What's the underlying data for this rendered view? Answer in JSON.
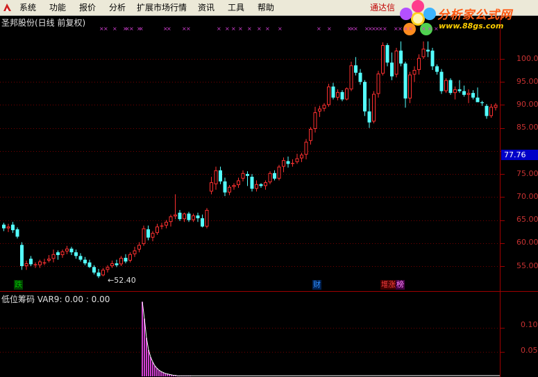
{
  "menu": {
    "items": [
      "系统",
      "功能",
      "报价",
      "分析",
      "扩展市场行情",
      "资讯",
      "工具",
      "帮助"
    ],
    "broker": "通达信"
  },
  "watermark": {
    "title": "分析家公式网",
    "url": "www.88gs.com"
  },
  "stock_title": "圣邦股份(日线 前复权)",
  "current_price_label": "77.76",
  "low_marker": "←52.40",
  "price_axis_ticks": [
    "100.0",
    "95.00",
    "90.00",
    "85.00",
    "75.00",
    "70.00",
    "65.00",
    "60.00",
    "55.00"
  ],
  "events": [
    {
      "label": "跌",
      "color": "#00c000",
      "bg": "#004000"
    },
    {
      "label": "财",
      "color": "#3090ff",
      "bg": "#002050"
    },
    {
      "label": "增",
      "color": "#ff4040",
      "bg": "#400000"
    },
    {
      "label": "涨",
      "color": "#ff4040",
      "bg": "#400000"
    },
    {
      "label": "榜",
      "color": "#ff80ff",
      "bg": "#400040"
    }
  ],
  "indicator": {
    "title": "低位筹码  VAR9: 0.00  : 0.00",
    "ticks": [
      "0.10",
      "0.05"
    ]
  },
  "colors": {
    "up": "#ff3030",
    "down": "#54ffff",
    "marker": "#d040d0",
    "grid": "#7a0000"
  },
  "chart_data": {
    "type": "candlestick",
    "ylim": [
      51,
      104
    ],
    "candles": [
      [
        64,
        64.4,
        62.6,
        63.2
      ],
      [
        63.2,
        64.2,
        62.4,
        63.6
      ],
      [
        64,
        64.6,
        62.2,
        62.8
      ],
      [
        63,
        63.4,
        61,
        61.4
      ],
      [
        59.6,
        60.2,
        54.2,
        55
      ],
      [
        55,
        56.2,
        54.2,
        55.6
      ],
      [
        56.6,
        57.2,
        55,
        55.4
      ],
      [
        55.2,
        55.8,
        54.6,
        55.4
      ],
      [
        55.2,
        56.4,
        54.6,
        56
      ],
      [
        55.6,
        56.6,
        55.2,
        55.8
      ],
      [
        56.2,
        57.4,
        55.8,
        56.6
      ],
      [
        56.6,
        58.6,
        55.8,
        57.6
      ],
      [
        58,
        58.4,
        56.4,
        57.4
      ],
      [
        57.4,
        58.6,
        56.8,
        58.2
      ],
      [
        58.2,
        59.4,
        57.6,
        58.8
      ],
      [
        58.8,
        59.2,
        57.4,
        58
      ],
      [
        58,
        58.6,
        56.6,
        57.2
      ],
      [
        57.2,
        57.8,
        56,
        56.4
      ],
      [
        56.4,
        57,
        55.2,
        55.6
      ],
      [
        55.8,
        56.4,
        54.6,
        54.8
      ],
      [
        54.8,
        55.2,
        53.2,
        53.6
      ],
      [
        53.6,
        54.4,
        52.4,
        52.8
      ],
      [
        53,
        54.6,
        52.8,
        54.2
      ],
      [
        54.2,
        55.2,
        53.6,
        54.8
      ],
      [
        55,
        56.2,
        54.6,
        55.6
      ],
      [
        55.6,
        56.4,
        54.8,
        55.2
      ],
      [
        55.4,
        57.2,
        55,
        56.8
      ],
      [
        56.8,
        57.6,
        55.6,
        56
      ],
      [
        56.2,
        58,
        55.8,
        57.6
      ],
      [
        57.6,
        59.2,
        57,
        58.4
      ],
      [
        58.6,
        60.2,
        58,
        59.6
      ],
      [
        59.8,
        63.8,
        59.4,
        63.2
      ],
      [
        63,
        63.8,
        60.6,
        61.2
      ],
      [
        61.2,
        62.6,
        60.4,
        62.2
      ],
      [
        62.2,
        64.2,
        61.8,
        63.6
      ],
      [
        63.6,
        64.4,
        63,
        63.8
      ],
      [
        63.8,
        65,
        63.2,
        64.6
      ],
      [
        64.6,
        66.2,
        63.6,
        65.8
      ],
      [
        65.8,
        70.6,
        65.2,
        66.2
      ],
      [
        66.6,
        67.2,
        64.8,
        65.2
      ],
      [
        65.2,
        66.6,
        64.6,
        66.4
      ],
      [
        66.4,
        66.8,
        64.6,
        65
      ],
      [
        65,
        66.4,
        64.6,
        66
      ],
      [
        66,
        66.6,
        64.6,
        65.4
      ],
      [
        65.4,
        66.2,
        63.4,
        63.6
      ],
      [
        63.6,
        67.6,
        63.2,
        67.2
      ],
      [
        71.2,
        74.4,
        70.6,
        73.2
      ],
      [
        72.8,
        76.6,
        71.6,
        75.8
      ],
      [
        75.8,
        76.6,
        72.8,
        73.4
      ],
      [
        73.4,
        74.2,
        70.2,
        71
      ],
      [
        71,
        72.6,
        70.4,
        72.2
      ],
      [
        72.2,
        73,
        71.6,
        72.6
      ],
      [
        72.6,
        74.2,
        72,
        73.6
      ],
      [
        74,
        75.8,
        73.4,
        75.2
      ],
      [
        75,
        75.6,
        72.4,
        74.6
      ],
      [
        74.4,
        75,
        71.2,
        71.8
      ],
      [
        71.8,
        73.6,
        71.2,
        72.8
      ],
      [
        72.8,
        73,
        72,
        72.4
      ],
      [
        72.4,
        73.6,
        71.6,
        73.2
      ],
      [
        73.2,
        75.6,
        72.8,
        75.2
      ],
      [
        75.2,
        75.8,
        73.6,
        74
      ],
      [
        74,
        77,
        73.6,
        76.6
      ],
      [
        76.6,
        78.6,
        75.4,
        78
      ],
      [
        77.8,
        78.8,
        76.4,
        77.2
      ],
      [
        77.2,
        78.2,
        76.6,
        77.4
      ],
      [
        77.6,
        79.4,
        77.2,
        78.4
      ],
      [
        78.4,
        79.6,
        77.6,
        79.2
      ],
      [
        79.2,
        82.6,
        78.2,
        82
      ],
      [
        82.2,
        85.2,
        81.4,
        84.8
      ],
      [
        84.8,
        89.6,
        84,
        88.4
      ],
      [
        88.6,
        89.8,
        87.4,
        89.2
      ],
      [
        89.2,
        90.4,
        88.6,
        90
      ],
      [
        90,
        94.6,
        89.6,
        94
      ],
      [
        94,
        94.8,
        91.2,
        91.6
      ],
      [
        91.6,
        93.4,
        91,
        92.8
      ],
      [
        92.8,
        93.2,
        90.8,
        91.2
      ],
      [
        91.2,
        93.8,
        91,
        93.6
      ],
      [
        93.4,
        99.4,
        93,
        98.6
      ],
      [
        98.6,
        100.4,
        96.4,
        97
      ],
      [
        97,
        97.8,
        94.4,
        95
      ],
      [
        95,
        95.4,
        87.6,
        88.6
      ],
      [
        88.6,
        91.4,
        85,
        86.2
      ],
      [
        86.4,
        93,
        86,
        92.4
      ],
      [
        92.4,
        97.4,
        91.6,
        96.8
      ],
      [
        96.8,
        103.6,
        96.4,
        103
      ],
      [
        103,
        103.4,
        98.4,
        99.2
      ],
      [
        99.2,
        101.4,
        95.4,
        96.2
      ],
      [
        96.6,
        102.4,
        96,
        101.8
      ],
      [
        101.8,
        103.8,
        98.4,
        99
      ],
      [
        99,
        99.4,
        89.4,
        91.4
      ],
      [
        91.4,
        97.2,
        90.4,
        96.6
      ],
      [
        96.6,
        98.4,
        95,
        97.6
      ],
      [
        97.6,
        101,
        96.6,
        100.2
      ],
      [
        100.4,
        103.8,
        100,
        102.2
      ],
      [
        102,
        103.8,
        100.4,
        101.6
      ],
      [
        101.8,
        102.4,
        97.6,
        98.4
      ],
      [
        98.4,
        98.8,
        96.6,
        97.2
      ],
      [
        97.2,
        97.8,
        92.4,
        93
      ],
      [
        93,
        95.8,
        92.6,
        95.4
      ],
      [
        95.4,
        95.8,
        92.2,
        92.6
      ],
      [
        92.6,
        94,
        91.2,
        93.4
      ],
      [
        93.4,
        95.4,
        92.6,
        93
      ],
      [
        93,
        94.2,
        91.8,
        92.2
      ],
      [
        92.2,
        93.4,
        90.4,
        92.6
      ],
      [
        92.6,
        93.2,
        91.2,
        91.6
      ],
      [
        91.6,
        93.8,
        91.2,
        90.6
      ],
      [
        90.6,
        90.9,
        89.8,
        90.4
      ],
      [
        89.8,
        90.2,
        87,
        87.6
      ],
      [
        87.6,
        90.2,
        87.2,
        89.6
      ],
      [
        89.4,
        90.4,
        88.8,
        90
      ]
    ],
    "indicator_values": [
      0.155,
      0.12,
      0.08,
      0.055,
      0.04,
      0.03,
      0.022,
      0.017,
      0.013,
      0.01,
      0.008,
      0.006,
      0.005,
      0.004,
      0.003,
      0.002,
      0.002,
      0.001,
      0.001,
      0.001,
      0.001,
      0.001,
      0.001,
      0.001
    ]
  }
}
